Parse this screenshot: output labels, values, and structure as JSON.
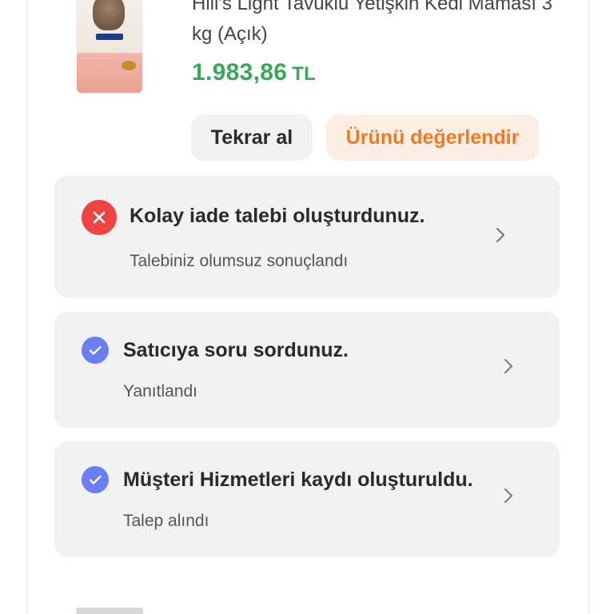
{
  "product": {
    "title": "Hill's Light Tavuklu Yetişkin Kedi Maması 3 kg (Açık)",
    "price_value": "1.983,86",
    "price_currency": "TL"
  },
  "actions": {
    "buy_again_label": "Tekrar al",
    "review_label": "Ürünü değerlendir"
  },
  "activities": [
    {
      "title": "Kolay iade talebi oluşturdunuz.",
      "subtitle": "Talebiniz olumsuz sonuçlandı",
      "status": "error",
      "icon": "close-icon"
    },
    {
      "title": "Satıcıya soru sordunuz.",
      "subtitle": "Yanıtlandı",
      "status": "success",
      "icon": "check-icon"
    },
    {
      "title": "Müşteri Hizmetleri kaydı oluşturuldu.",
      "subtitle": "Talep alındı",
      "status": "success",
      "icon": "check-icon"
    }
  ],
  "colors": {
    "price": "#3aa85a",
    "review_accent": "#f07a22",
    "error": "#ef4444",
    "success": "#6a7ef0",
    "card_bg": "#f2f2f3"
  }
}
